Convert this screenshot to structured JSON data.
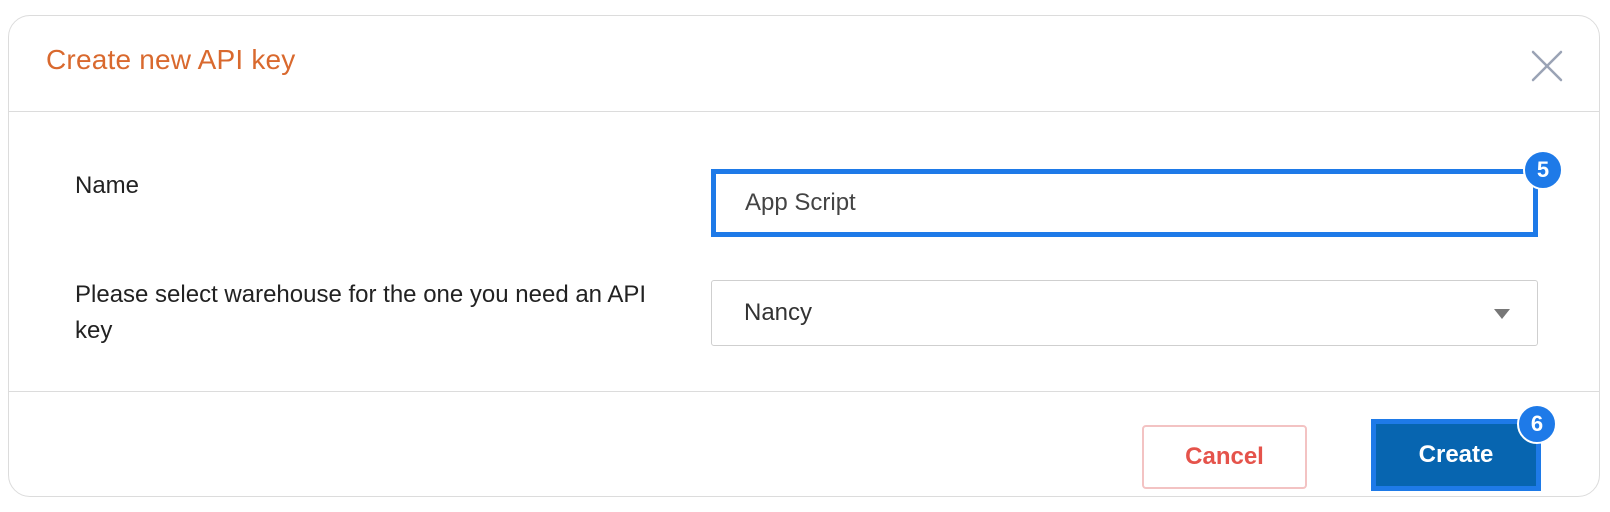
{
  "dialog": {
    "title": "Create new API key",
    "close_icon": "close-icon"
  },
  "form": {
    "name_label": "Name",
    "name_value": "App Script",
    "warehouse_label": "Please select warehouse for the one you need an API key",
    "warehouse_value": "Nancy"
  },
  "footer": {
    "cancel_label": "Cancel",
    "create_label": "Create"
  },
  "annotations": {
    "badge_name": "5",
    "badge_create": "6"
  },
  "colors": {
    "title": "#d9692e",
    "highlight": "#1e7ae8",
    "primary": "#0765b0",
    "cancel_text": "#e5534b"
  }
}
